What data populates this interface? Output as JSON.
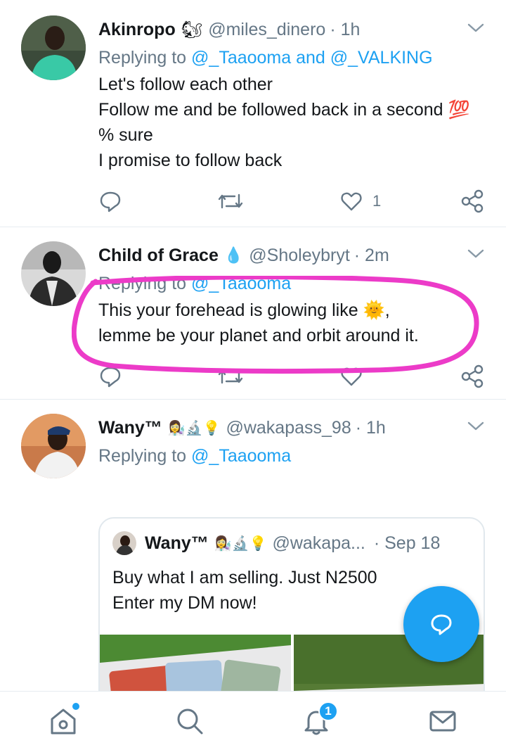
{
  "tweets": [
    {
      "name": "Akinropo",
      "name_emoji": "🐿",
      "handle": "@miles_dinero",
      "time": "· 1h",
      "replying_prefix": "Replying to ",
      "replying_mentions": "@_Taaooma and @_VALKING",
      "text": "Let's follow each other\n Follow me and be followed back in a second 💯 % sure\nI promise to follow back",
      "like_count": "1"
    },
    {
      "name": "Child of Grace",
      "name_emoji": "💧",
      "handle": "@Sholeybryt",
      "time": "· 2m",
      "replying_prefix": "Replying to ",
      "replying_mentions": "@_Taaooma",
      "text": "This your forehead is glowing like 🌞,\nlemme be your planet and orbit around it."
    },
    {
      "name": "Wany™",
      "name_emoji": "👩‍🔬🔬💡",
      "handle": "@wakapass_98",
      "time": "· 1h",
      "replying_prefix": "Replying to ",
      "replying_mentions": "@_Taaooma",
      "quote": {
        "name": "Wany™",
        "name_emoji": "👩‍🔬🔬💡",
        "handle": "@wakapa...",
        "time": "· Sep 18",
        "text": "Buy what I am selling. Just N2500\nEnter my DM now!"
      }
    }
  ],
  "tabbar": {
    "items": [
      "home-icon",
      "search-icon",
      "notifications-icon",
      "messages-icon"
    ],
    "notification_badge": "1"
  },
  "colors": {
    "accent": "#1da1f2",
    "highlight": "#ec3bc8",
    "secondary_text": "#657786"
  }
}
